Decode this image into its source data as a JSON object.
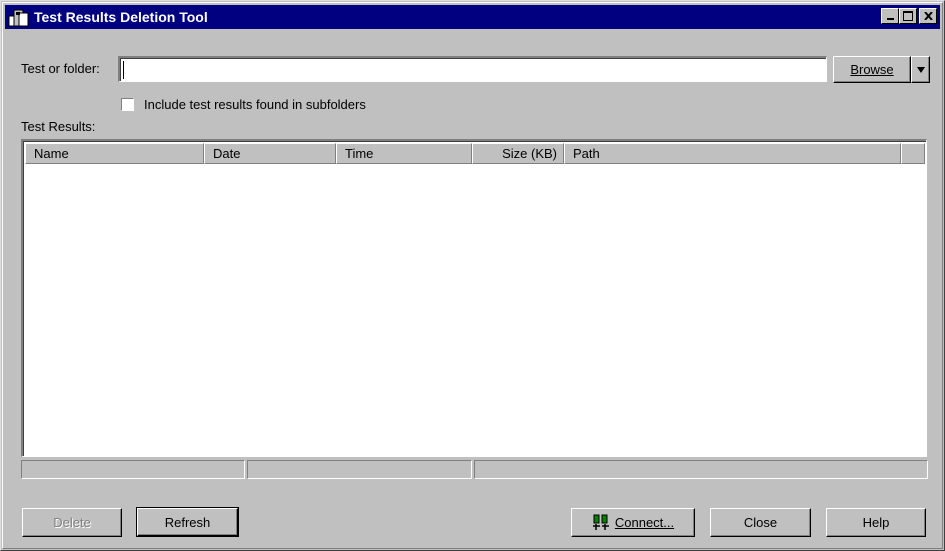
{
  "window": {
    "title": "Test Results Deletion Tool",
    "controls": {
      "minimize": "_",
      "maximize": "□",
      "close": "×"
    }
  },
  "form": {
    "test_or_folder_label": "Test or folder:",
    "test_or_folder_value": "",
    "browse_label": "Browse",
    "include_subfolders_label": "Include test results found in subfolders",
    "include_subfolders_checked": false,
    "test_results_label": "Test Results:"
  },
  "results": {
    "columns": [
      "Name",
      "Date",
      "Time",
      "Size (KB)",
      "Path",
      ""
    ],
    "rows": []
  },
  "status": {
    "panes": [
      "",
      "",
      ""
    ]
  },
  "buttons": {
    "delete": "Delete",
    "refresh": "Refresh",
    "connect": "Connect...",
    "close": "Close",
    "help": "Help"
  },
  "colors": {
    "title_bar": "#000080",
    "face": "#c0c0c0",
    "disabled_text": "#808080"
  }
}
